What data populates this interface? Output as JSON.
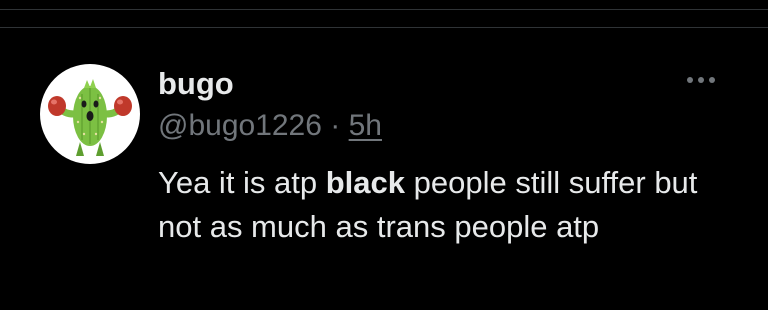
{
  "tweet": {
    "display_name": "bugo",
    "handle": "@bugo1226",
    "separator": "·",
    "time": "5h",
    "text_before_bold": "Yea it is atp ",
    "text_bold": "black",
    "text_after_bold": " people still suffer but not as much as trans people atp"
  },
  "avatar": {
    "icon": "cactuar-boxer-avatar",
    "background_color": "#ffffff",
    "body_color": "#7cc043",
    "glove_color": "#c0392b"
  },
  "more_icon": "more-dots-icon",
  "colors": {
    "background": "#000000",
    "primary_text": "#e7e9ea",
    "secondary_text": "#71767b",
    "divider": "#2f3336"
  }
}
